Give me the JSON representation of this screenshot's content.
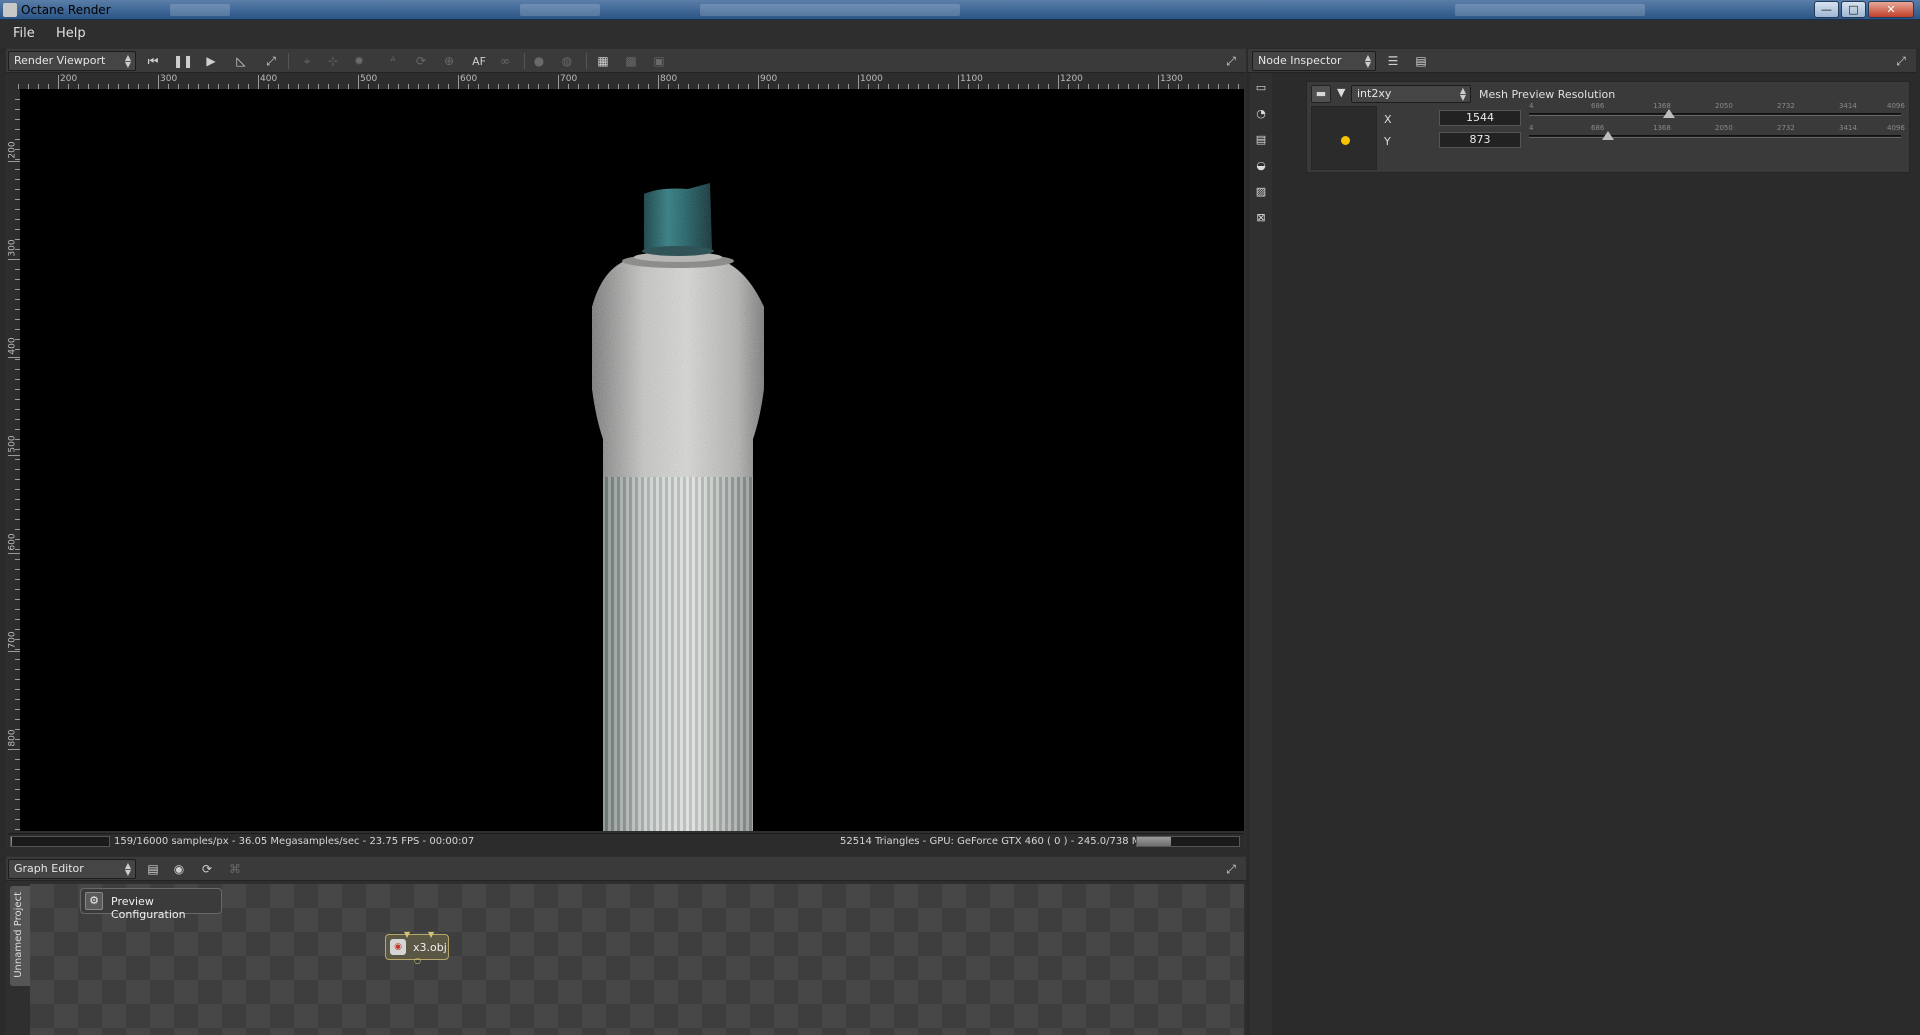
{
  "window": {
    "title": "Octane Render",
    "minimize": "—",
    "maximize": "□",
    "close": "✕"
  },
  "menu": {
    "file": "File",
    "help": "Help"
  },
  "render_viewport": {
    "panel_label": "Render Viewport",
    "ruler_h": [
      "200",
      "300",
      "400",
      "500",
      "600",
      "700",
      "800",
      "900",
      "1000",
      "1100",
      "1200",
      "1300"
    ],
    "ruler_v": [
      "200",
      "300",
      "400",
      "500",
      "600",
      "700",
      "800"
    ],
    "toolbar": {
      "icons": [
        "rewind-icon",
        "pause-icon",
        "play-icon",
        "ruler-icon",
        "resize-icon",
        "pick-icon",
        "focus-icon",
        "sun-icon",
        "af-icon",
        "rotate-icon",
        "zoom-icon",
        "af-label-icon",
        "glasses-icon",
        "sphere-icon",
        "sphere2-icon",
        "region-icon",
        "grid-icon",
        "window-icon"
      ],
      "af_label": "AF"
    },
    "status_left": "159/16000 samples/px - 36.05 Megasamples/sec - 23.75 FPS - 00:00:07",
    "status_right": "52514 Triangles - GPU: GeForce GTX 460 ( 0 ) - 245.0/738 MB Mem Used",
    "sample_progress": 0.01,
    "memory_progress": 0.33
  },
  "graph_editor": {
    "panel_label": "Graph Editor",
    "project_tab": "Unnamed Project",
    "preview_node": "Preview Configuration",
    "mesh_node": "x3.obj"
  },
  "node_inspector": {
    "panel_label": "Node Inspector",
    "node_type": "int2xy",
    "node_label": "Mesh Preview Resolution",
    "x_label": "X",
    "x_value": "1544",
    "y_label": "Y",
    "y_value": "873",
    "slider_min": 4,
    "slider_max": 4096,
    "slider_ticks": [
      "4",
      "686",
      "1368",
      "2050",
      "2732",
      "3414",
      "4096"
    ],
    "accent_color": "#f5c400"
  }
}
